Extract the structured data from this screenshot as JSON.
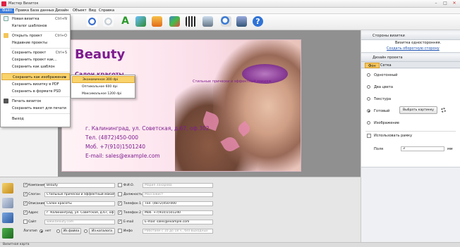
{
  "window": {
    "title": "Мастер Визиток"
  },
  "menu": [
    "Файл",
    "Правка",
    "База данных",
    "Дизайн",
    "Объект",
    "Вид",
    "Справка"
  ],
  "file_menu": [
    {
      "label": "Новая визитка",
      "shortcut": "Ctrl+N"
    },
    {
      "label": "Каталог шаблонов",
      "shortcut": ""
    },
    {
      "label": "Открыть проект",
      "shortcut": "Ctrl+O"
    },
    {
      "label": "Недавние проекты",
      "shortcut": ""
    },
    {
      "label": "Сохранить проект",
      "shortcut": "Ctrl+S"
    },
    {
      "label": "Сохранить проект как...",
      "shortcut": ""
    },
    {
      "label": "Сохранить как шаблон",
      "shortcut": ""
    },
    {
      "label": "Сохранить как изображение",
      "shortcut": ""
    },
    {
      "label": "Сохранить визитку в PDF",
      "shortcut": ""
    },
    {
      "label": "Сохранить в формате PSD",
      "shortcut": ""
    },
    {
      "label": "Печать визиток",
      "shortcut": ""
    },
    {
      "label": "Сохранить макет для печати",
      "shortcut": ""
    },
    {
      "label": "Выход",
      "shortcut": ""
    }
  ],
  "save_image_submenu": [
    "Экономичное 300 dpi",
    "Оптимальное 600 dpi",
    "Максимальное 1200 dpi"
  ],
  "card": {
    "name": "Beauty",
    "slogan": "Салон красоты",
    "description": "Стильные прически и эффектный макияж",
    "address": "г. Калининград, ул. Советская, д.67, оф.302",
    "tel": "Тел. (4872)450-000",
    "mobile": "Моб. +7(910)1501240",
    "email": "E-mail: sales@example.com"
  },
  "right": {
    "sides_header": "Стороны визитки",
    "sides_note": "Визитка односторонняя.",
    "sides_link": "Создать оборотную сторону",
    "design_header": "Дизайн проекта",
    "tabs": [
      "Фон",
      "Сетка"
    ],
    "bg_options": [
      "Однотонный",
      "Два цвета",
      "Текстура",
      "Готовый",
      "Изображение"
    ],
    "choose_button": "Выбрать картинку",
    "use_frame": "Использовать рамку",
    "margins_label": "Поля",
    "margins_value": "3",
    "margins_unit": "мм"
  },
  "fields": {
    "company_label": "Компания",
    "company_value": "Beauty",
    "slogan_label": "Слоган",
    "slogan_value": "Стильные прически и эффектный макияж",
    "desc_label": "Описание",
    "desc_value": "Салон красоты",
    "addr_label": "Адрес",
    "addr_value": "г. Калининград, ул. Советская, д.67, оф.302",
    "site_label": "Сайт",
    "site_value": "www.beauty.com",
    "logo_label": "Логотип",
    "logo_none": "нет",
    "logo_file": "Из файла",
    "logo_catalog": "Из каталога",
    "fio_label": "Ф.И.О.",
    "fio_value": "Мария Захарова",
    "post_label": "Должность",
    "post_value": "Массажист",
    "tel1_label": "Телефон 1",
    "tel1_value": "Тел. (4872)450-000",
    "tel2_label": "Телефон 2",
    "tel2_value": "Моб. +7(910)1501240",
    "email_label": "E-mail",
    "email_value": "E-mail: sales@example.com",
    "info_label": "Инфо",
    "info_value": "Работаем с 10 до 18 ч., без выходных"
  },
  "status": "Визитная карта",
  "colors": {
    "accent": "#7d1c8f",
    "highlight": "#f9d36b",
    "menu_active": "#3c7ddb"
  }
}
